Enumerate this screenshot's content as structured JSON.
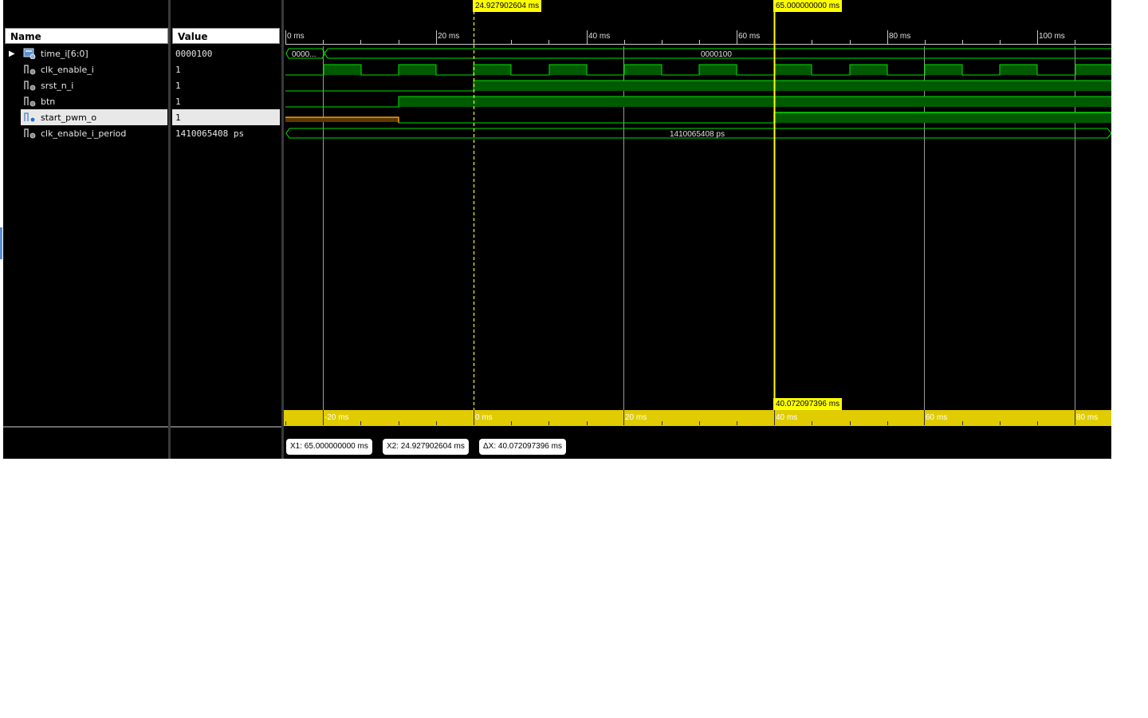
{
  "columns": {
    "name": "Name",
    "value": "Value"
  },
  "signals": [
    {
      "name": "time_i[6:0]",
      "value": "0000100",
      "icon": "bus-signal-icon",
      "expandable": true
    },
    {
      "name": "clk_enable_i",
      "value": "1",
      "icon": "logic-signal-icon"
    },
    {
      "name": "srst_n_i",
      "value": "1",
      "icon": "logic-signal-icon"
    },
    {
      "name": "btn",
      "value": "1",
      "icon": "logic-signal-icon"
    },
    {
      "name": "start_pwm_o",
      "value": "1",
      "icon": "output-signal-icon",
      "selected": true
    },
    {
      "name": "clk_enable_i_period",
      "value": "1410065408 ps",
      "icon": "logic-signal-icon"
    }
  ],
  "waves": {
    "time_i_first": "0000...",
    "time_i_main": "0000100",
    "period_label": "1410065408 ps"
  },
  "top_ruler": {
    "labels": [
      "0 ms",
      "20 ms",
      "40 ms",
      "60 ms",
      "80 ms",
      "100 ms"
    ]
  },
  "bottom_ruler": {
    "labels": [
      "-20 ms",
      "0 ms",
      "20 ms",
      "40 ms",
      "60 ms",
      "80 ms"
    ]
  },
  "cursors": {
    "x2_tag": "24.927902604 ms",
    "x1_tag": "65.000000000 ms",
    "delta_tag": "40.072097396 ms"
  },
  "status": {
    "x1": "X1: 65.000000000 ms",
    "x2": "X2: 24.927902604 ms",
    "dx": "ΔX: 40.072097396 ms"
  },
  "colors": {
    "wave": "#00e000",
    "wave_fill": "#005a00",
    "undefined": "#ff9900",
    "cursor": "#ffff00",
    "ruler_bg": "#e0cc00",
    "grid": "#ffffff"
  }
}
